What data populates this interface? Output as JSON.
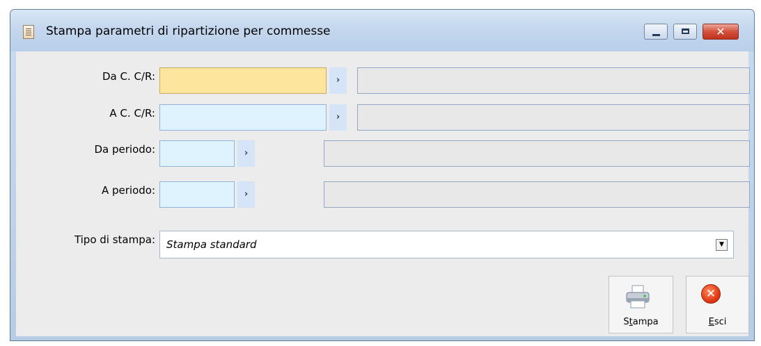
{
  "window": {
    "title": "Stampa parametri di ripartizione per commesse",
    "close_glyph": "✕"
  },
  "form": {
    "da_cc": {
      "label": "Da C. C/R:",
      "value": "",
      "description": ""
    },
    "a_cc": {
      "label": "A C. C/R:",
      "value": "",
      "description": ""
    },
    "da_periodo": {
      "label": "Da periodo:",
      "value": "",
      "description": ""
    },
    "a_periodo": {
      "label": "A periodo:",
      "value": "",
      "description": ""
    },
    "zoom_glyph": "›",
    "tipo_stampa": {
      "label": "Tipo di stampa:",
      "value": "Stampa standard",
      "arrow_glyph": "▼"
    }
  },
  "buttons": {
    "stampa": {
      "label_prefix": "S",
      "label_underline": "t",
      "label_suffix": "ampa",
      "icon": "printer-icon"
    },
    "esci": {
      "label_underline": "E",
      "label_suffix": "sci",
      "icon": "close-circle-icon",
      "icon_glyph": "✕"
    }
  },
  "colors": {
    "focus_field": "#fde59e",
    "input_field": "#def3fd",
    "readonly_field": "#e8e8e8",
    "dialog_background": "#ececec",
    "title_bar": "#c4d7ee"
  }
}
